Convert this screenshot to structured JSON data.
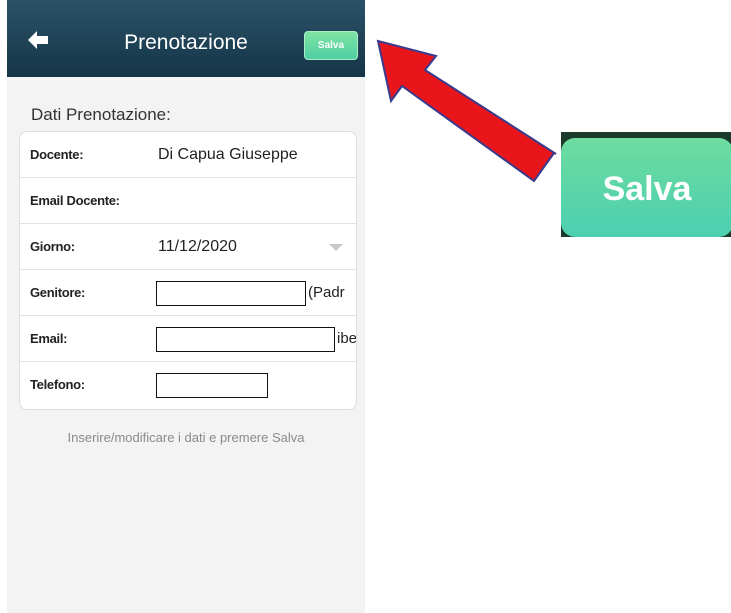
{
  "header": {
    "title": "Prenotazione",
    "save_label": "Salva"
  },
  "section_heading": "Dati Prenotazione:",
  "form": {
    "rows": [
      {
        "label": "Docente:",
        "value": "Di Capua Giuseppe"
      },
      {
        "label": "Email Docente:",
        "value": ""
      },
      {
        "label": "Giorno:",
        "value": "11/12/2020"
      },
      {
        "label": "Genitore:",
        "value": "",
        "overflow_text": "(Padr"
      },
      {
        "label": "Email:",
        "value": "",
        "overflow_text": "ibe"
      },
      {
        "label": "Telefono:",
        "value": ""
      }
    ]
  },
  "hint": "Inserire/modificare i dati e premere Salva",
  "callout": {
    "zoomed_button_label": "Salva"
  },
  "colors": {
    "header_bg": "#1f4256",
    "save_button": "#5fd8a2",
    "arrow": "#e8151b"
  },
  "icons": {
    "back": "arrow-left-icon",
    "dropdown": "chevron-down-icon"
  }
}
